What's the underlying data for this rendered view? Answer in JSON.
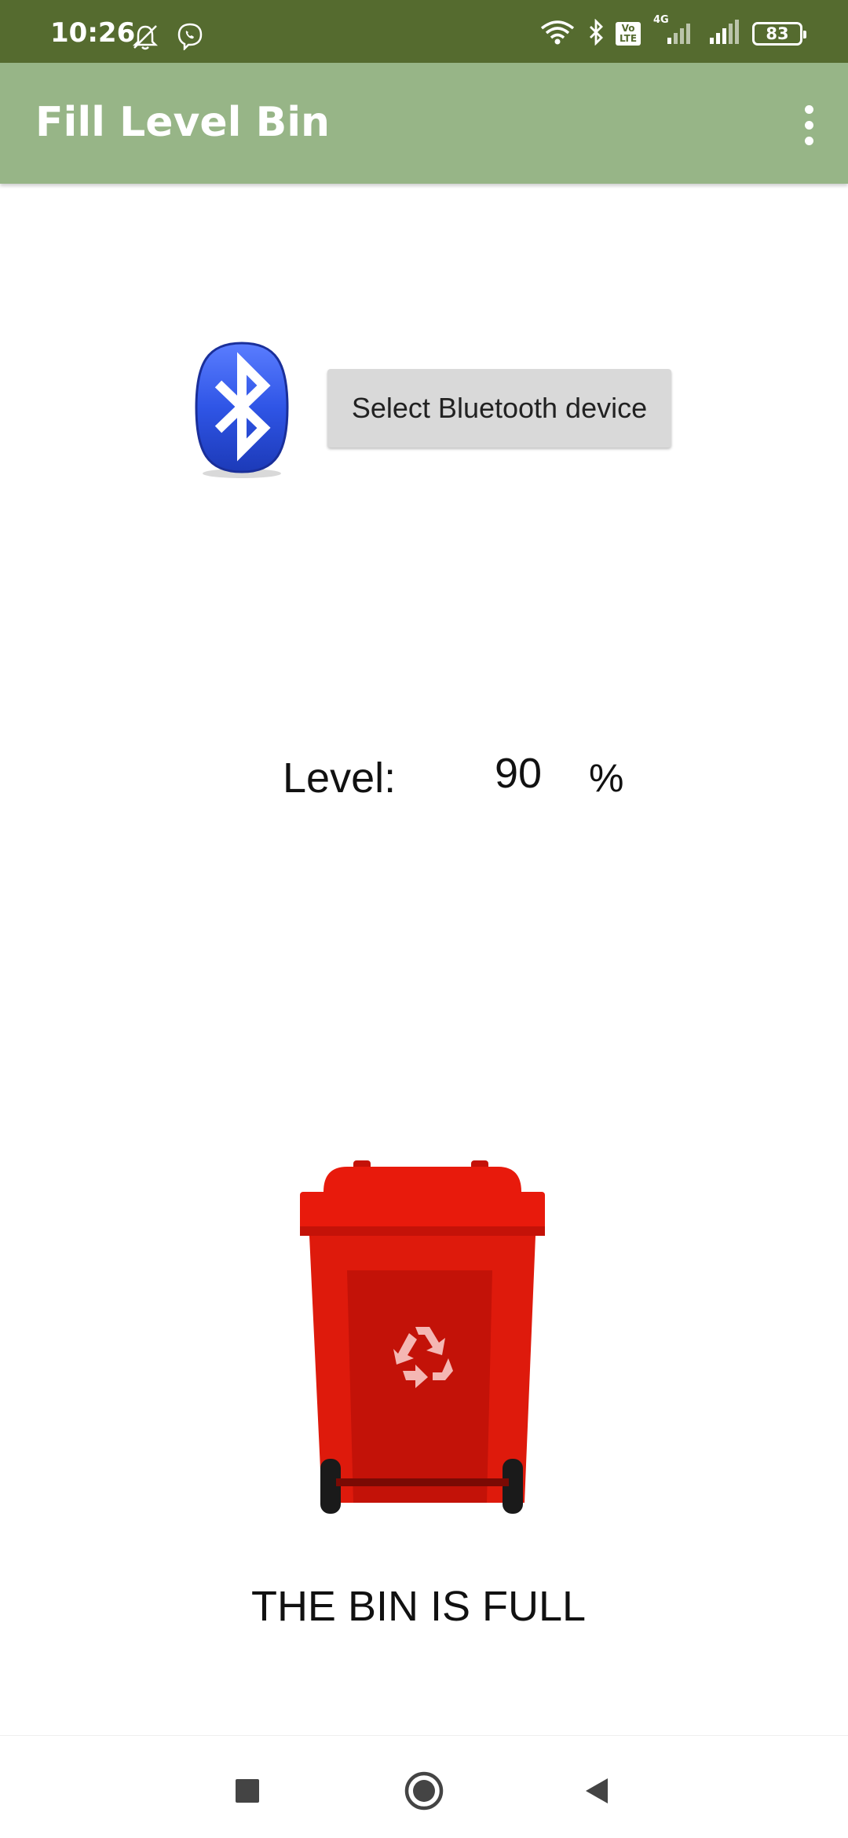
{
  "status_bar": {
    "time": "10:26",
    "left_icons": [
      "mute-bell-icon",
      "viber-icon"
    ],
    "right_icons": [
      "wifi-icon",
      "bluetooth-status-icon",
      "volte-icon",
      "signal-4g-icon",
      "signal-icon",
      "battery-icon"
    ],
    "volte_label": "Vo LTE",
    "network": "4G",
    "battery": "83"
  },
  "app_bar": {
    "title": "Fill Level Bin",
    "menu_icon": "overflow-menu-icon"
  },
  "bluetooth": {
    "icon": "bluetooth-icon",
    "button_label": "Select Bluetooth device"
  },
  "level": {
    "label": "Level:",
    "value": "90",
    "unit": "%"
  },
  "bin": {
    "icon": "recycle-bin-icon",
    "color": "#e01507",
    "status_text": "THE BIN IS FULL"
  },
  "nav_bar": {
    "icons": [
      "recents-icon",
      "home-icon",
      "back-icon"
    ]
  },
  "colors": {
    "status_bar": "#556b2f",
    "app_bar": "#97b587",
    "button_bg": "#d9d9d9"
  }
}
